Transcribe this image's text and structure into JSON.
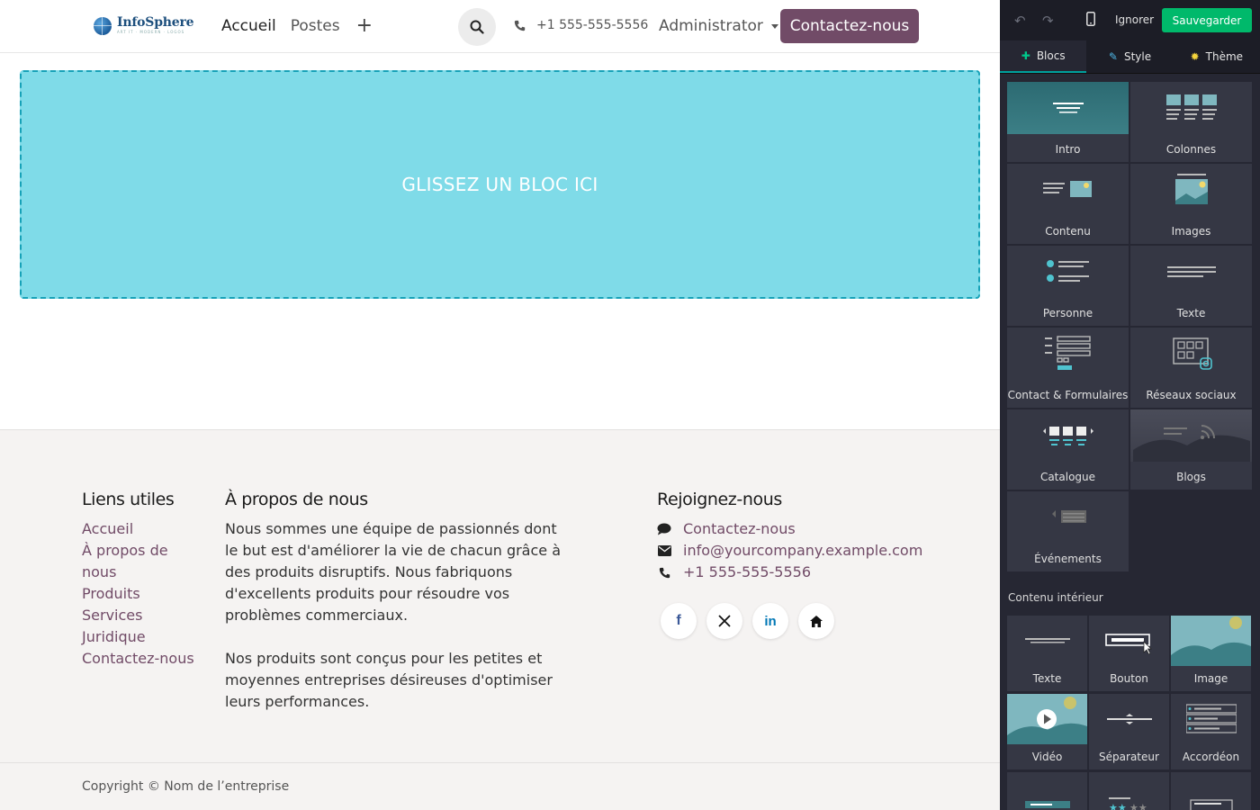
{
  "colors": {
    "brand": "#714b67",
    "dropzone_bg": "#7fdbe8",
    "dropzone_border": "#17a2b8",
    "editor_bg": "#262733",
    "save_green": "#00b96b",
    "tab_accent": "#00a09d"
  },
  "header": {
    "logo_name": "InfoSphere",
    "logo_tagline": "ART IT · MODERN · LOGOS",
    "nav": [
      "Accueil",
      "Postes"
    ],
    "add_icon": "plus-icon",
    "phone": "+1 555-555-5556",
    "user_menu": "Administrator",
    "cta": "Contactez-nous"
  },
  "dropzone": {
    "text": "GLISSEZ UN BLOC ICI"
  },
  "footer": {
    "links_title": "Liens utiles",
    "links": [
      "Accueil",
      "À propos de nous",
      "Produits",
      "Services",
      "Juridique",
      "Contactez-nous"
    ],
    "about_title": "À propos de nous",
    "about_p1": "Nous sommes une équipe de passionnés dont le but est d'améliorer la vie de chacun grâce à des produits disruptifs. Nous fabriquons d'excellents produits pour résoudre vos problèmes commerciaux.",
    "about_p2": "Nos produits sont conçus pour les petites et moyennes entreprises désireuses d'optimiser leurs performances.",
    "join_title": "Rejoignez-nous",
    "contact_label": "Contactez-nous",
    "email": "info@yourcompany.example.com",
    "phone": "+1 555-555-5556",
    "socials": [
      "facebook-icon",
      "x-icon",
      "linkedin-icon",
      "home-icon"
    ],
    "copyright": "Copyright © Nom de l’entreprise"
  },
  "editor": {
    "ignore": "Ignorer",
    "save": "Sauvegarder",
    "tabs": [
      "Blocs",
      "Style",
      "Thème"
    ],
    "blocks": [
      "Intro",
      "Colonnes",
      "Contenu",
      "Images",
      "Personne",
      "Texte",
      "Contact & Formulaires",
      "Réseaux sociaux",
      "Catalogue",
      "Blogs",
      "Événements"
    ],
    "inner_title": "Contenu intérieur",
    "inner_blocks": [
      "Texte",
      "Bouton",
      "Image",
      "Vidéo",
      "Séparateur",
      "Accordéon",
      "",
      "",
      ""
    ]
  }
}
